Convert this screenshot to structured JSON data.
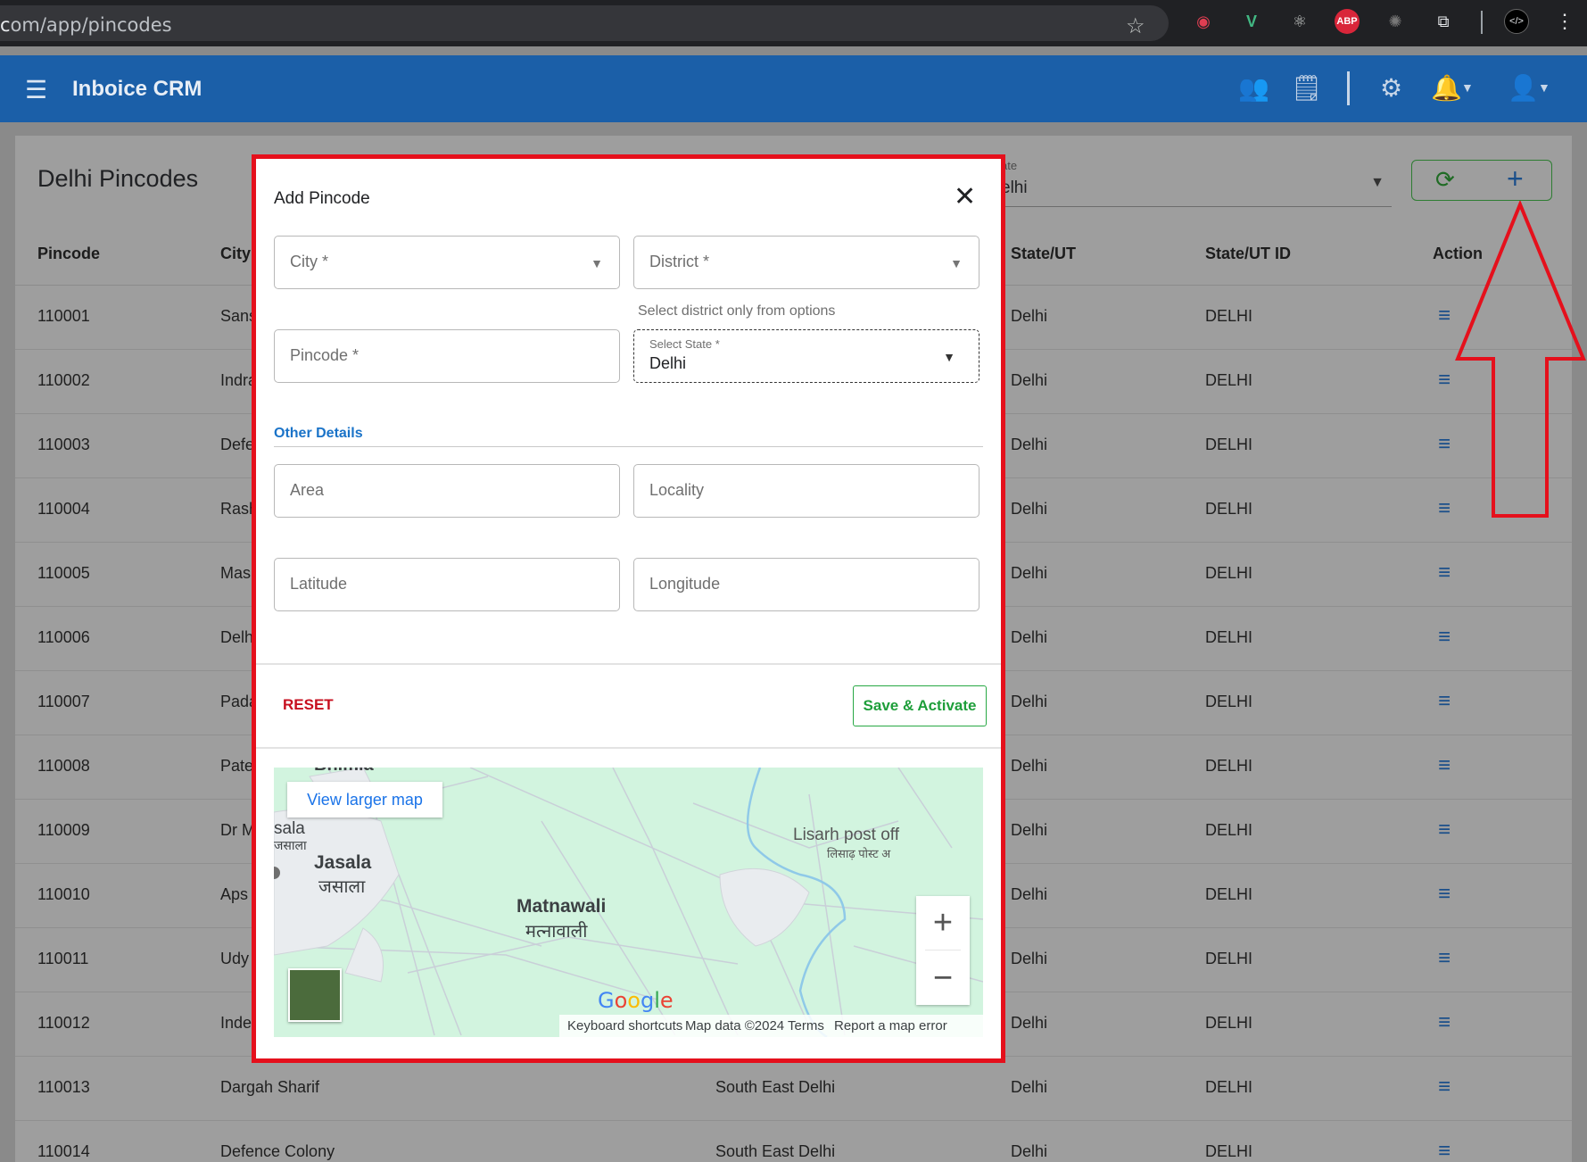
{
  "browser": {
    "url_suffix": "om/app/pincodes"
  },
  "appbar": {
    "brand": "Inboice CRM"
  },
  "page": {
    "title": "Delhi Pincodes",
    "state_filter": {
      "label": "ate",
      "value": "elhi"
    },
    "columns": [
      "Pincode",
      "City",
      "State/UT",
      "State/UT ID",
      "Action"
    ],
    "rows": [
      {
        "pincode": "110001",
        "city": "Sans",
        "district": "",
        "state": "Delhi",
        "state_id": "DELHI"
      },
      {
        "pincode": "110002",
        "city": "Indra",
        "district": "",
        "state": "Delhi",
        "state_id": "DELHI"
      },
      {
        "pincode": "110003",
        "city": "Defe",
        "district": "",
        "state": "Delhi",
        "state_id": "DELHI"
      },
      {
        "pincode": "110004",
        "city": "Rash",
        "district": "",
        "state": "Delhi",
        "state_id": "DELHI"
      },
      {
        "pincode": "110005",
        "city": "Mas",
        "district": "",
        "state": "Delhi",
        "state_id": "DELHI"
      },
      {
        "pincode": "110006",
        "city": "Delh",
        "district": "",
        "state": "Delhi",
        "state_id": "DELHI"
      },
      {
        "pincode": "110007",
        "city": "Pada",
        "district": "",
        "state": "Delhi",
        "state_id": "DELHI"
      },
      {
        "pincode": "110008",
        "city": "Pate",
        "district": "",
        "state": "Delhi",
        "state_id": "DELHI"
      },
      {
        "pincode": "110009",
        "city": "Dr M",
        "district": "",
        "state": "Delhi",
        "state_id": "DELHI"
      },
      {
        "pincode": "110010",
        "city": "Aps",
        "district": "",
        "state": "Delhi",
        "state_id": "DELHI"
      },
      {
        "pincode": "110011",
        "city": "Udy",
        "district": "",
        "state": "Delhi",
        "state_id": "DELHI"
      },
      {
        "pincode": "110012",
        "city": "Inde",
        "district": "",
        "state": "Delhi",
        "state_id": "DELHI"
      },
      {
        "pincode": "110013",
        "city": "Dargah Sharif",
        "district": "South East Delhi",
        "state": "Delhi",
        "state_id": "DELHI"
      },
      {
        "pincode": "110014",
        "city": "Defence Colony",
        "district": "South East Delhi",
        "state": "Delhi",
        "state_id": "DELHI"
      }
    ]
  },
  "modal": {
    "title": "Add Pincode",
    "fields": {
      "city": "City *",
      "district": "District *",
      "district_helper": "Select district only from options",
      "pincode": "Pincode *",
      "state_label": "Select State *",
      "state_value": "Delhi",
      "area": "Area",
      "locality": "Locality",
      "latitude": "Latitude",
      "longitude": "Longitude"
    },
    "section_title": "Other Details",
    "reset_label": "RESET",
    "save_label": "Save & Activate",
    "map": {
      "view_larger": "View larger map",
      "labels": {
        "top_partial": "Bhimla",
        "sala": "sala",
        "sala_hi": "जसाला",
        "jasala": "Jasala",
        "jasala_hi": "जसाला",
        "matnawali": "Matnawali",
        "matnawali_hi": "मत्नावाली",
        "lisarh": "Lisarh post off",
        "lisarh_hi": "लिसाढ़ पोस्ट अ"
      },
      "google": "Google",
      "footer": {
        "shortcuts": "Keyboard shortcuts",
        "data": "Map data ©2024",
        "terms": "Terms",
        "report": "Report a map error"
      }
    }
  }
}
